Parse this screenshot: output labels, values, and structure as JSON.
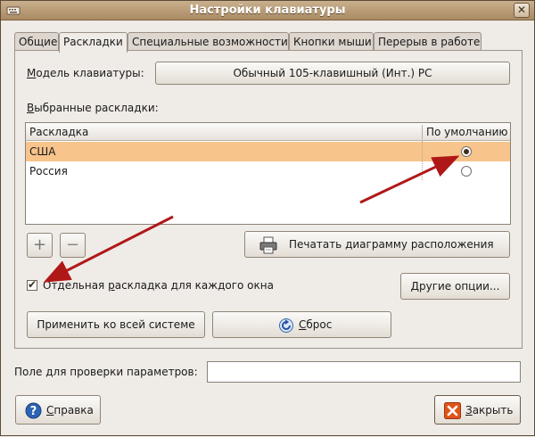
{
  "window": {
    "title": "Настройки клавиатуры",
    "close_glyph": "✕"
  },
  "tabs": [
    {
      "label": "Общие",
      "active": false
    },
    {
      "label": "Раскладки",
      "active": true
    },
    {
      "label": "Специальные возможности",
      "active": false
    },
    {
      "label": "Кнопки мыши",
      "active": false
    },
    {
      "label": "Перерыв в работе",
      "active": false
    }
  ],
  "model": {
    "label_first": "М",
    "label_rest": "одель клавиатуры:",
    "value": "Обычный 105-клавишный (Инт.) PC"
  },
  "layouts": {
    "label_first": "В",
    "label_rest": "ыбранные раскладки:",
    "col_layout": "Раскладка",
    "col_default": "По умолчанию",
    "rows": [
      {
        "name": "США",
        "default": true
      },
      {
        "name": "Россия",
        "default": false
      }
    ]
  },
  "buttons": {
    "add": "+",
    "remove": "−",
    "print": "Печатать диаграмму расположения",
    "separate_first": "Отдельная ",
    "separate_u": "р",
    "separate_rest": "аскладка для каждого окна",
    "other_options": "Другие опции...",
    "apply_all": "Применить ко всей системе",
    "reset_u": "С",
    "reset_rest": "брос",
    "help_u": "С",
    "help_rest": "правка",
    "close_u": "З",
    "close_rest": "акрыть"
  },
  "test_field": {
    "label": "Поле для проверки параметров:",
    "value": ""
  },
  "checkbox": {
    "checked": true,
    "mark": "✔"
  },
  "colors": {
    "selection": "#f7c48c",
    "arrow": "#b01818",
    "help_icon": "#2b63b5",
    "close_icon": "#e0531b"
  }
}
